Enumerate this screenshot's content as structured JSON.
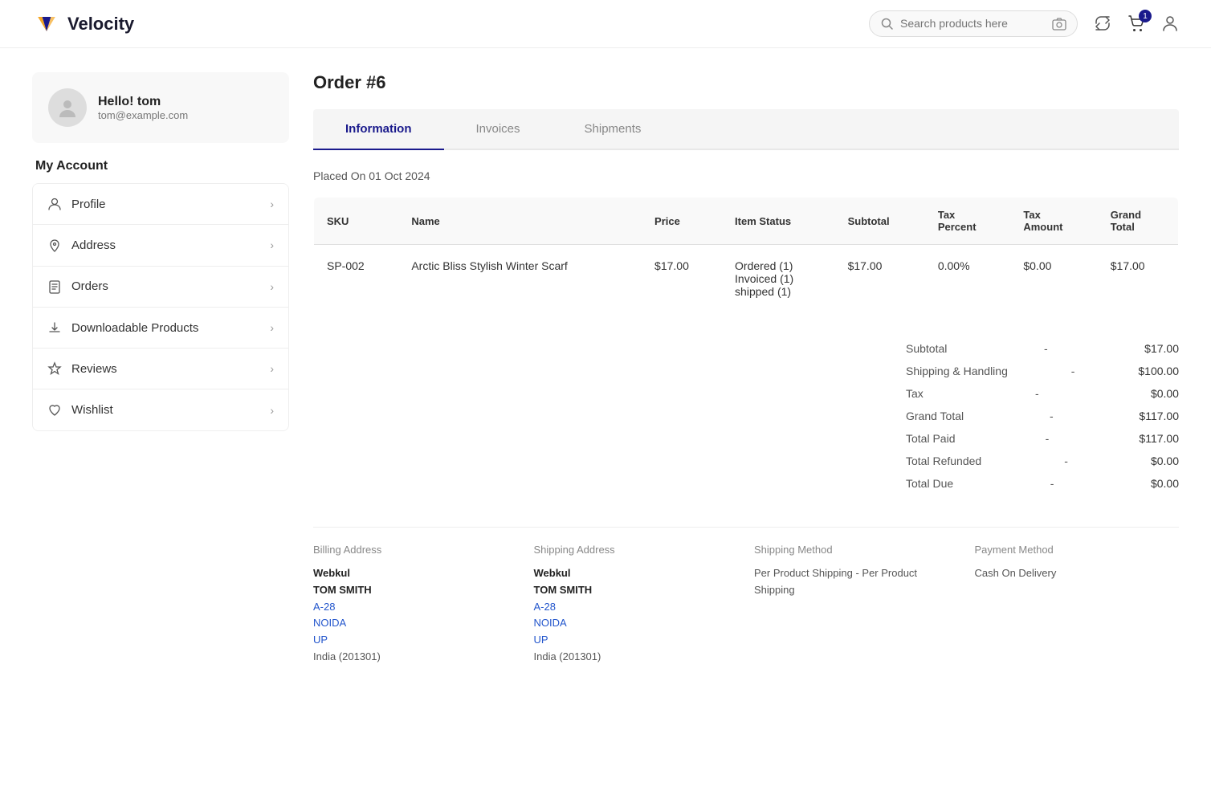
{
  "header": {
    "logo_text": "Velocity",
    "search_placeholder": "Search products here",
    "cart_badge": "1"
  },
  "sidebar": {
    "user_greeting": "Hello! tom",
    "user_email": "tom@example.com",
    "my_account_label": "My Account",
    "items": [
      {
        "id": "profile",
        "label": "Profile",
        "icon": "person"
      },
      {
        "id": "address",
        "label": "Address",
        "icon": "location"
      },
      {
        "id": "orders",
        "label": "Orders",
        "icon": "clipboard"
      },
      {
        "id": "downloadable-products",
        "label": "Downloadable Products",
        "icon": "download"
      },
      {
        "id": "reviews",
        "label": "Reviews",
        "icon": "star"
      },
      {
        "id": "wishlist",
        "label": "Wishlist",
        "icon": "heart"
      }
    ]
  },
  "order": {
    "title": "Order #6",
    "placed_on_label": "Placed On",
    "placed_on_date": "01 Oct 2024",
    "tabs": [
      {
        "id": "information",
        "label": "Information",
        "active": true
      },
      {
        "id": "invoices",
        "label": "Invoices",
        "active": false
      },
      {
        "id": "shipments",
        "label": "Shipments",
        "active": false
      }
    ],
    "table": {
      "headers": [
        "SKU",
        "Name",
        "Price",
        "Item Status",
        "Subtotal",
        "Tax Percent",
        "Tax Amount",
        "Grand Total"
      ],
      "rows": [
        {
          "sku": "SP-002",
          "name": "Arctic Bliss Stylish Winter Scarf",
          "price": "$17.00",
          "item_status": "Ordered (1)\nInvoiced (1)\nshipped (1)",
          "subtotal": "$17.00",
          "tax_percent": "0.00%",
          "tax_amount": "$0.00",
          "grand_total": "$17.00"
        }
      ]
    },
    "summary": {
      "subtotal_label": "Subtotal",
      "subtotal_value": "$17.00",
      "shipping_label": "Shipping & Handling",
      "shipping_value": "$100.00",
      "tax_label": "Tax",
      "tax_value": "$0.00",
      "grand_total_label": "Grand Total",
      "grand_total_value": "$117.00",
      "total_paid_label": "Total Paid",
      "total_paid_value": "$117.00",
      "total_refunded_label": "Total Refunded",
      "total_refunded_value": "$0.00",
      "total_due_label": "Total Due",
      "total_due_value": "$0.00"
    },
    "billing_address": {
      "section_label": "Billing Address",
      "company": "Webkul",
      "name": "TOM SMITH",
      "line1": "A-28",
      "city": "NOIDA",
      "state": "UP",
      "country_zip": "India (201301)"
    },
    "shipping_address": {
      "section_label": "Shipping Address",
      "company": "Webkul",
      "name": "TOM SMITH",
      "line1": "A-28",
      "city": "NOIDA",
      "state": "UP",
      "country_zip": "India (201301)"
    },
    "shipping_method": {
      "section_label": "Shipping Method",
      "value": "Per Product Shipping - Per Product Shipping"
    },
    "payment_method": {
      "section_label": "Payment Method",
      "value": "Cash On Delivery"
    }
  }
}
